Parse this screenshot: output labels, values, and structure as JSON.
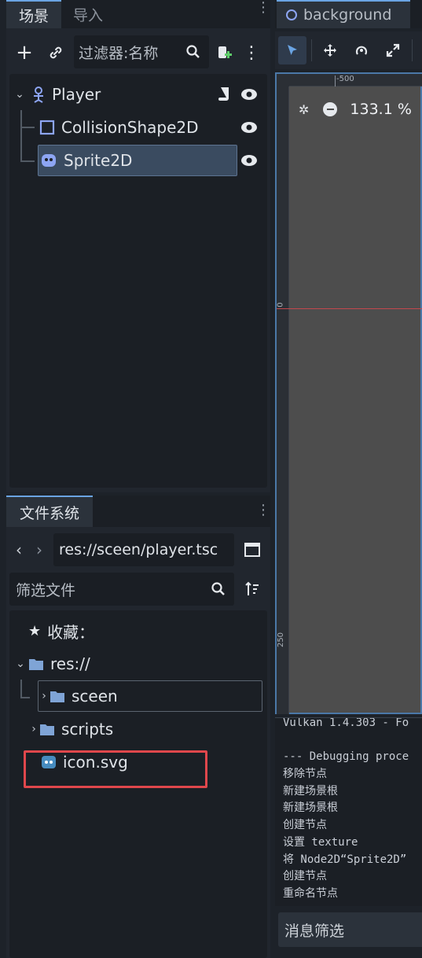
{
  "scene_dock": {
    "tabs": [
      {
        "label": "场景",
        "active": true
      },
      {
        "label": "导入",
        "active": false
      }
    ],
    "filter_placeholder": "过滤器:名称",
    "tree": [
      {
        "label": "Player",
        "icon": "node2d-icon"
      },
      {
        "label": "CollisionShape2D",
        "icon": "collision-shape-icon"
      },
      {
        "label": "Sprite2D",
        "icon": "sprite-icon",
        "selected": true
      }
    ]
  },
  "filesystem_dock": {
    "tab_label": "文件系统",
    "path": "res://sceen/player.tsc",
    "filter_placeholder": "筛选文件",
    "favorites_label": "收藏：",
    "items": [
      {
        "label": "res://",
        "type": "folder"
      },
      {
        "label": "sceen",
        "type": "folder"
      },
      {
        "label": "scripts",
        "type": "folder"
      },
      {
        "label": "icon.svg",
        "type": "file"
      }
    ]
  },
  "editor": {
    "scene_tab": "background",
    "zoom": "133.1 %",
    "ruler_top": [
      "-500"
    ],
    "ruler_left": [
      "0",
      "250"
    ]
  },
  "output": {
    "lines": [
      "Vulkan 1.4.303 - Fo",
      "",
      "--- Debugging proce",
      "移除节点",
      "新建场景根",
      "新建场景根",
      "创建节点",
      "设置 texture",
      "将 Node2D“Sprite2D”",
      "创建节点",
      "重命名节点"
    ],
    "filter_label": "消息筛选"
  },
  "colors": {
    "accent": "#6aa4e3",
    "highlight_box": "#e0474c",
    "selected_row": "#3a4b60"
  }
}
